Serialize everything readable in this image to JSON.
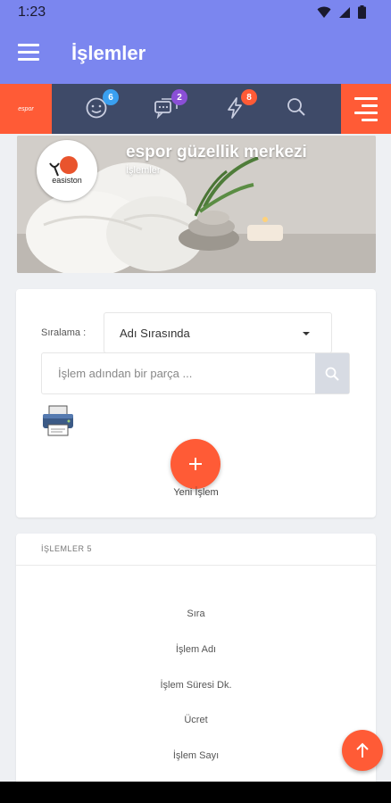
{
  "status_bar": {
    "time": "1:23"
  },
  "app_bar": {
    "title": "İşlemler"
  },
  "toolbar": {
    "brand": "espor",
    "badges": {
      "smiley": "6",
      "chat": "2",
      "flash": "8"
    },
    "colors": {
      "smiley_badge": "#3aa0f0",
      "chat_badge": "#8a4fd6",
      "flash_badge": "#ff5b36"
    }
  },
  "banner": {
    "business_name": "espor güzellik merkezi",
    "subtitle": "İşlemler",
    "logo_text": "easiston"
  },
  "controls": {
    "sort_label": "Sıralama :",
    "sort_value": "Adı Sırasında",
    "search_placeholder": "İşlem adından bir parça ...",
    "add_label": "Yeni İşlem"
  },
  "list": {
    "header": "İŞLEMLER 5",
    "columns": [
      "Sıra",
      "İşlem Adı",
      "İşlem Süresi Dk.",
      "Ücret",
      "İşlem Sayı"
    ]
  },
  "colors": {
    "primary": "#7b86ef",
    "accent": "#ff5b36",
    "toolbar_bg": "#3e4a68"
  }
}
